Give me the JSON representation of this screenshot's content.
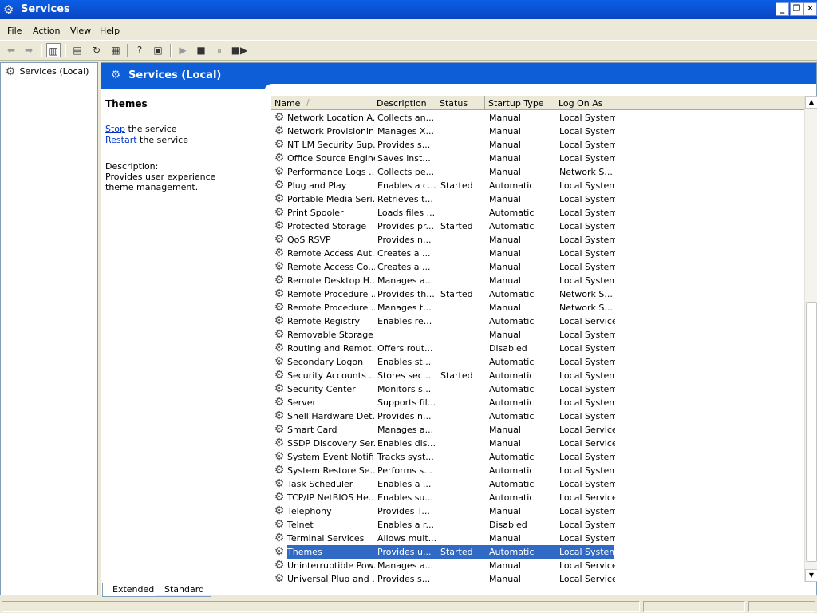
{
  "window": {
    "title": "Services",
    "icon": "gear-icon",
    "controls": {
      "minimize": "_",
      "restore": "❐",
      "close": "✕"
    }
  },
  "menu": [
    "File",
    "Action",
    "View",
    "Help"
  ],
  "toolbar": {
    "buttons": [
      {
        "name": "back-button",
        "glyph": "⬅",
        "state": "disabled"
      },
      {
        "name": "forward-button",
        "glyph": "➡",
        "state": "disabled"
      },
      {
        "name": "show-hide-tree-button",
        "glyph": "▥",
        "state": "pressed"
      },
      {
        "name": "properties-button",
        "glyph": "▤",
        "state": "normal"
      },
      {
        "name": "refresh-button",
        "glyph": "↻",
        "state": "normal"
      },
      {
        "name": "export-list-button",
        "glyph": "▦",
        "state": "normal"
      },
      {
        "name": "help-button",
        "glyph": "?",
        "state": "normal"
      },
      {
        "name": "show-hide-action-pane-button",
        "glyph": "▣",
        "state": "normal"
      },
      {
        "name": "start-service-button",
        "glyph": "▶",
        "state": "disabled"
      },
      {
        "name": "stop-service-button",
        "glyph": "■",
        "state": "normal"
      },
      {
        "name": "pause-service-button",
        "glyph": "⏸",
        "state": "disabled"
      },
      {
        "name": "restart-service-button",
        "glyph": "■▶",
        "state": "normal"
      }
    ]
  },
  "tree": {
    "root_label": "Services (Local)"
  },
  "banner": {
    "title": "Services (Local)"
  },
  "details": {
    "service_name": "Themes",
    "stop_link": "Stop",
    "stop_suffix": " the service",
    "restart_link": "Restart",
    "restart_suffix": " the service",
    "description_label": "Description:",
    "description_text": "Provides user experience theme management."
  },
  "list": {
    "columns": [
      {
        "key": "name",
        "label": "Name",
        "sort_indicator": "/"
      },
      {
        "key": "description",
        "label": "Description"
      },
      {
        "key": "status",
        "label": "Status"
      },
      {
        "key": "startup",
        "label": "Startup Type"
      },
      {
        "key": "logon",
        "label": "Log On As"
      }
    ],
    "rows": [
      {
        "name": "Network Location A...",
        "description": "Collects an...",
        "status": "",
        "startup": "Manual",
        "logon": "Local System"
      },
      {
        "name": "Network Provisionin...",
        "description": "Manages X...",
        "status": "",
        "startup": "Manual",
        "logon": "Local System"
      },
      {
        "name": "NT LM Security Sup...",
        "description": "Provides s...",
        "status": "",
        "startup": "Manual",
        "logon": "Local System"
      },
      {
        "name": "Office Source Engine",
        "description": "Saves inst...",
        "status": "",
        "startup": "Manual",
        "logon": "Local System"
      },
      {
        "name": "Performance Logs ...",
        "description": "Collects pe...",
        "status": "",
        "startup": "Manual",
        "logon": "Network S..."
      },
      {
        "name": "Plug and Play",
        "description": "Enables a c...",
        "status": "Started",
        "startup": "Automatic",
        "logon": "Local System"
      },
      {
        "name": "Portable Media Seri...",
        "description": "Retrieves t...",
        "status": "",
        "startup": "Manual",
        "logon": "Local System"
      },
      {
        "name": "Print Spooler",
        "description": "Loads files ...",
        "status": "",
        "startup": "Automatic",
        "logon": "Local System"
      },
      {
        "name": "Protected Storage",
        "description": "Provides pr...",
        "status": "Started",
        "startup": "Automatic",
        "logon": "Local System"
      },
      {
        "name": "QoS RSVP",
        "description": "Provides n...",
        "status": "",
        "startup": "Manual",
        "logon": "Local System"
      },
      {
        "name": "Remote Access Aut...",
        "description": "Creates a ...",
        "status": "",
        "startup": "Manual",
        "logon": "Local System"
      },
      {
        "name": "Remote Access Co...",
        "description": "Creates a ...",
        "status": "",
        "startup": "Manual",
        "logon": "Local System"
      },
      {
        "name": "Remote Desktop H...",
        "description": "Manages a...",
        "status": "",
        "startup": "Manual",
        "logon": "Local System"
      },
      {
        "name": "Remote Procedure ...",
        "description": "Provides th...",
        "status": "Started",
        "startup": "Automatic",
        "logon": "Network S..."
      },
      {
        "name": "Remote Procedure ...",
        "description": "Manages t...",
        "status": "",
        "startup": "Manual",
        "logon": "Network S..."
      },
      {
        "name": "Remote Registry",
        "description": "Enables re...",
        "status": "",
        "startup": "Automatic",
        "logon": "Local Service"
      },
      {
        "name": "Removable Storage",
        "description": "",
        "status": "",
        "startup": "Manual",
        "logon": "Local System"
      },
      {
        "name": "Routing and Remot...",
        "description": "Offers rout...",
        "status": "",
        "startup": "Disabled",
        "logon": "Local System"
      },
      {
        "name": "Secondary Logon",
        "description": "Enables st...",
        "status": "",
        "startup": "Automatic",
        "logon": "Local System"
      },
      {
        "name": "Security Accounts ...",
        "description": "Stores sec...",
        "status": "Started",
        "startup": "Automatic",
        "logon": "Local System"
      },
      {
        "name": "Security Center",
        "description": "Monitors s...",
        "status": "",
        "startup": "Automatic",
        "logon": "Local System"
      },
      {
        "name": "Server",
        "description": "Supports fil...",
        "status": "",
        "startup": "Automatic",
        "logon": "Local System"
      },
      {
        "name": "Shell Hardware Det...",
        "description": "Provides n...",
        "status": "",
        "startup": "Automatic",
        "logon": "Local System"
      },
      {
        "name": "Smart Card",
        "description": "Manages a...",
        "status": "",
        "startup": "Manual",
        "logon": "Local Service"
      },
      {
        "name": "SSDP Discovery Ser...",
        "description": "Enables dis...",
        "status": "",
        "startup": "Manual",
        "logon": "Local Service"
      },
      {
        "name": "System Event Notifi...",
        "description": "Tracks syst...",
        "status": "",
        "startup": "Automatic",
        "logon": "Local System"
      },
      {
        "name": "System Restore Se...",
        "description": "Performs s...",
        "status": "",
        "startup": "Automatic",
        "logon": "Local System"
      },
      {
        "name": "Task Scheduler",
        "description": "Enables a ...",
        "status": "",
        "startup": "Automatic",
        "logon": "Local System"
      },
      {
        "name": "TCP/IP NetBIOS He...",
        "description": "Enables su...",
        "status": "",
        "startup": "Automatic",
        "logon": "Local Service"
      },
      {
        "name": "Telephony",
        "description": "Provides T...",
        "status": "",
        "startup": "Manual",
        "logon": "Local System"
      },
      {
        "name": "Telnet",
        "description": "Enables a r...",
        "status": "",
        "startup": "Disabled",
        "logon": "Local System"
      },
      {
        "name": "Terminal Services",
        "description": "Allows mult...",
        "status": "",
        "startup": "Manual",
        "logon": "Local System"
      },
      {
        "name": "Themes",
        "description": "Provides u...",
        "status": "Started",
        "startup": "Automatic",
        "logon": "Local System",
        "selected": true
      },
      {
        "name": "Uninterruptible Pow...",
        "description": "Manages a...",
        "status": "",
        "startup": "Manual",
        "logon": "Local Service"
      },
      {
        "name": "Universal Plug and ...",
        "description": "Provides s...",
        "status": "",
        "startup": "Manual",
        "logon": "Local Service"
      }
    ]
  },
  "tabs": [
    {
      "label": "Extended",
      "active": true
    },
    {
      "label": "Standard",
      "active": false
    }
  ]
}
